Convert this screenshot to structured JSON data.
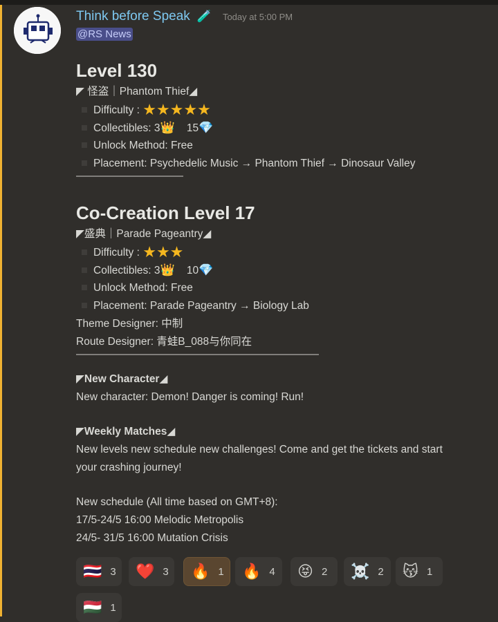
{
  "message": {
    "username": "Think before Speak",
    "bot_icon": "🧪",
    "timestamp": "Today at 5:00 PM",
    "mention": "@RS News"
  },
  "level": {
    "title": "Level 130",
    "theme": "◤ 怪盗｜Phantom Thief◢",
    "difficulty_label": "Difficulty :",
    "difficulty_stars": "★★★★★",
    "difficulty_rating": 5,
    "collectibles_label": "Collectibles: 3",
    "crown": "👑",
    "gems": "15",
    "gem": "💎",
    "unlock": "Unlock Method: Free",
    "placement": "Placement: Psychedelic Music → Phantom Thief → Dinosaur Valley",
    "divider": "———————————"
  },
  "cocreation": {
    "title": "Co-Creation Level 17",
    "theme": "◤盛典｜Parade Pageantry◢",
    "difficulty_label": "Difficulty :",
    "difficulty_stars": "★★★",
    "difficulty_rating": 3,
    "collectibles_label": "Collectibles: 3",
    "crown": "👑",
    "gems": "10",
    "gem": "💎",
    "unlock": "Unlock Method: Free",
    "placement": "Placement: Parade Pageantry → Biology Lab",
    "theme_designer": "Theme Designer: 中制",
    "route_designer": "Route Designer: 青蛙B_088与你同在",
    "divider": "—————————————————————————"
  },
  "new_character": {
    "heading": "◤New Character◢",
    "text": "New character: Demon! Danger is coming! Run!"
  },
  "weekly": {
    "heading": "◤Weekly Matches◢",
    "text1": "New levels new schedule new challenges! Come and get the tickets and start",
    "text2": "your crashing journey!",
    "schedule_title": "New schedule (All time based on GMT+8):",
    "schedule1": "17/5-24/5 16:00 Melodic Metropolis",
    "schedule2": "24/5- 31/5 16:00 Mutation Crisis"
  },
  "reactions": [
    {
      "emoji": "🇹🇭",
      "count": "3",
      "active": false
    },
    {
      "emoji": "❤️",
      "count": "3",
      "active": false
    },
    {
      "emoji": "🔥",
      "count": "1",
      "active": true
    },
    {
      "emoji": "🔥",
      "count": "4",
      "active": false
    },
    {
      "emoji": "😝",
      "count": "2",
      "active": false
    },
    {
      "emoji": "☠️",
      "count": "2",
      "active": false
    },
    {
      "emoji": "😽",
      "count": "1",
      "active": false
    },
    {
      "emoji": "🇭🇺",
      "count": "1",
      "active": false
    }
  ]
}
